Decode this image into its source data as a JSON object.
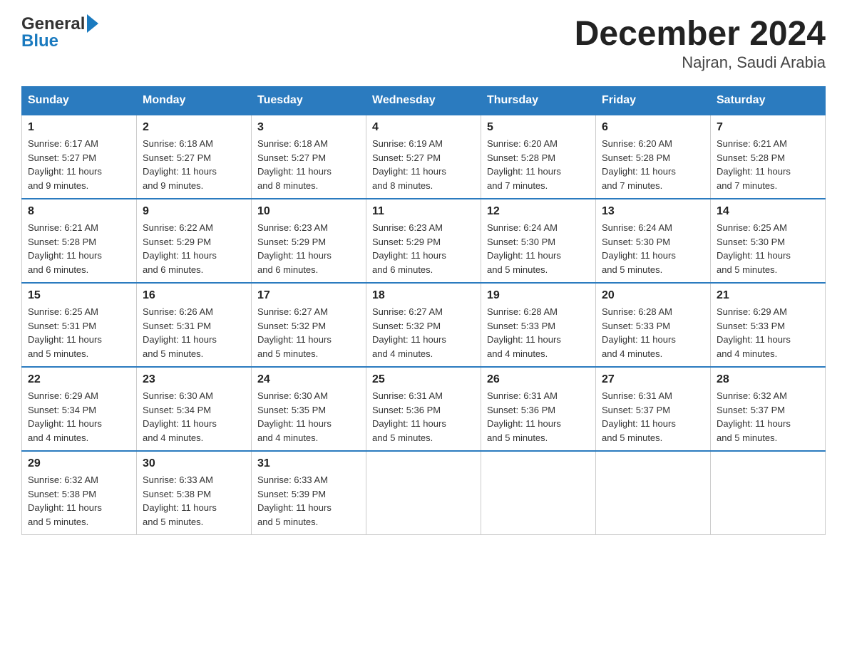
{
  "header": {
    "month_title": "December 2024",
    "location": "Najran, Saudi Arabia",
    "logo_general": "General",
    "logo_blue": "Blue"
  },
  "days_of_week": [
    "Sunday",
    "Monday",
    "Tuesday",
    "Wednesday",
    "Thursday",
    "Friday",
    "Saturday"
  ],
  "weeks": [
    [
      {
        "day": "1",
        "sunrise": "6:17 AM",
        "sunset": "5:27 PM",
        "daylight": "11 hours and 9 minutes."
      },
      {
        "day": "2",
        "sunrise": "6:18 AM",
        "sunset": "5:27 PM",
        "daylight": "11 hours and 9 minutes."
      },
      {
        "day": "3",
        "sunrise": "6:18 AM",
        "sunset": "5:27 PM",
        "daylight": "11 hours and 8 minutes."
      },
      {
        "day": "4",
        "sunrise": "6:19 AM",
        "sunset": "5:27 PM",
        "daylight": "11 hours and 8 minutes."
      },
      {
        "day": "5",
        "sunrise": "6:20 AM",
        "sunset": "5:28 PM",
        "daylight": "11 hours and 7 minutes."
      },
      {
        "day": "6",
        "sunrise": "6:20 AM",
        "sunset": "5:28 PM",
        "daylight": "11 hours and 7 minutes."
      },
      {
        "day": "7",
        "sunrise": "6:21 AM",
        "sunset": "5:28 PM",
        "daylight": "11 hours and 7 minutes."
      }
    ],
    [
      {
        "day": "8",
        "sunrise": "6:21 AM",
        "sunset": "5:28 PM",
        "daylight": "11 hours and 6 minutes."
      },
      {
        "day": "9",
        "sunrise": "6:22 AM",
        "sunset": "5:29 PM",
        "daylight": "11 hours and 6 minutes."
      },
      {
        "day": "10",
        "sunrise": "6:23 AM",
        "sunset": "5:29 PM",
        "daylight": "11 hours and 6 minutes."
      },
      {
        "day": "11",
        "sunrise": "6:23 AM",
        "sunset": "5:29 PM",
        "daylight": "11 hours and 6 minutes."
      },
      {
        "day": "12",
        "sunrise": "6:24 AM",
        "sunset": "5:30 PM",
        "daylight": "11 hours and 5 minutes."
      },
      {
        "day": "13",
        "sunrise": "6:24 AM",
        "sunset": "5:30 PM",
        "daylight": "11 hours and 5 minutes."
      },
      {
        "day": "14",
        "sunrise": "6:25 AM",
        "sunset": "5:30 PM",
        "daylight": "11 hours and 5 minutes."
      }
    ],
    [
      {
        "day": "15",
        "sunrise": "6:25 AM",
        "sunset": "5:31 PM",
        "daylight": "11 hours and 5 minutes."
      },
      {
        "day": "16",
        "sunrise": "6:26 AM",
        "sunset": "5:31 PM",
        "daylight": "11 hours and 5 minutes."
      },
      {
        "day": "17",
        "sunrise": "6:27 AM",
        "sunset": "5:32 PM",
        "daylight": "11 hours and 5 minutes."
      },
      {
        "day": "18",
        "sunrise": "6:27 AM",
        "sunset": "5:32 PM",
        "daylight": "11 hours and 4 minutes."
      },
      {
        "day": "19",
        "sunrise": "6:28 AM",
        "sunset": "5:33 PM",
        "daylight": "11 hours and 4 minutes."
      },
      {
        "day": "20",
        "sunrise": "6:28 AM",
        "sunset": "5:33 PM",
        "daylight": "11 hours and 4 minutes."
      },
      {
        "day": "21",
        "sunrise": "6:29 AM",
        "sunset": "5:33 PM",
        "daylight": "11 hours and 4 minutes."
      }
    ],
    [
      {
        "day": "22",
        "sunrise": "6:29 AM",
        "sunset": "5:34 PM",
        "daylight": "11 hours and 4 minutes."
      },
      {
        "day": "23",
        "sunrise": "6:30 AM",
        "sunset": "5:34 PM",
        "daylight": "11 hours and 4 minutes."
      },
      {
        "day": "24",
        "sunrise": "6:30 AM",
        "sunset": "5:35 PM",
        "daylight": "11 hours and 4 minutes."
      },
      {
        "day": "25",
        "sunrise": "6:31 AM",
        "sunset": "5:36 PM",
        "daylight": "11 hours and 5 minutes."
      },
      {
        "day": "26",
        "sunrise": "6:31 AM",
        "sunset": "5:36 PM",
        "daylight": "11 hours and 5 minutes."
      },
      {
        "day": "27",
        "sunrise": "6:31 AM",
        "sunset": "5:37 PM",
        "daylight": "11 hours and 5 minutes."
      },
      {
        "day": "28",
        "sunrise": "6:32 AM",
        "sunset": "5:37 PM",
        "daylight": "11 hours and 5 minutes."
      }
    ],
    [
      {
        "day": "29",
        "sunrise": "6:32 AM",
        "sunset": "5:38 PM",
        "daylight": "11 hours and 5 minutes."
      },
      {
        "day": "30",
        "sunrise": "6:33 AM",
        "sunset": "5:38 PM",
        "daylight": "11 hours and 5 minutes."
      },
      {
        "day": "31",
        "sunrise": "6:33 AM",
        "sunset": "5:39 PM",
        "daylight": "11 hours and 5 minutes."
      },
      null,
      null,
      null,
      null
    ]
  ],
  "labels": {
    "sunrise": "Sunrise:",
    "sunset": "Sunset:",
    "daylight": "Daylight:"
  }
}
